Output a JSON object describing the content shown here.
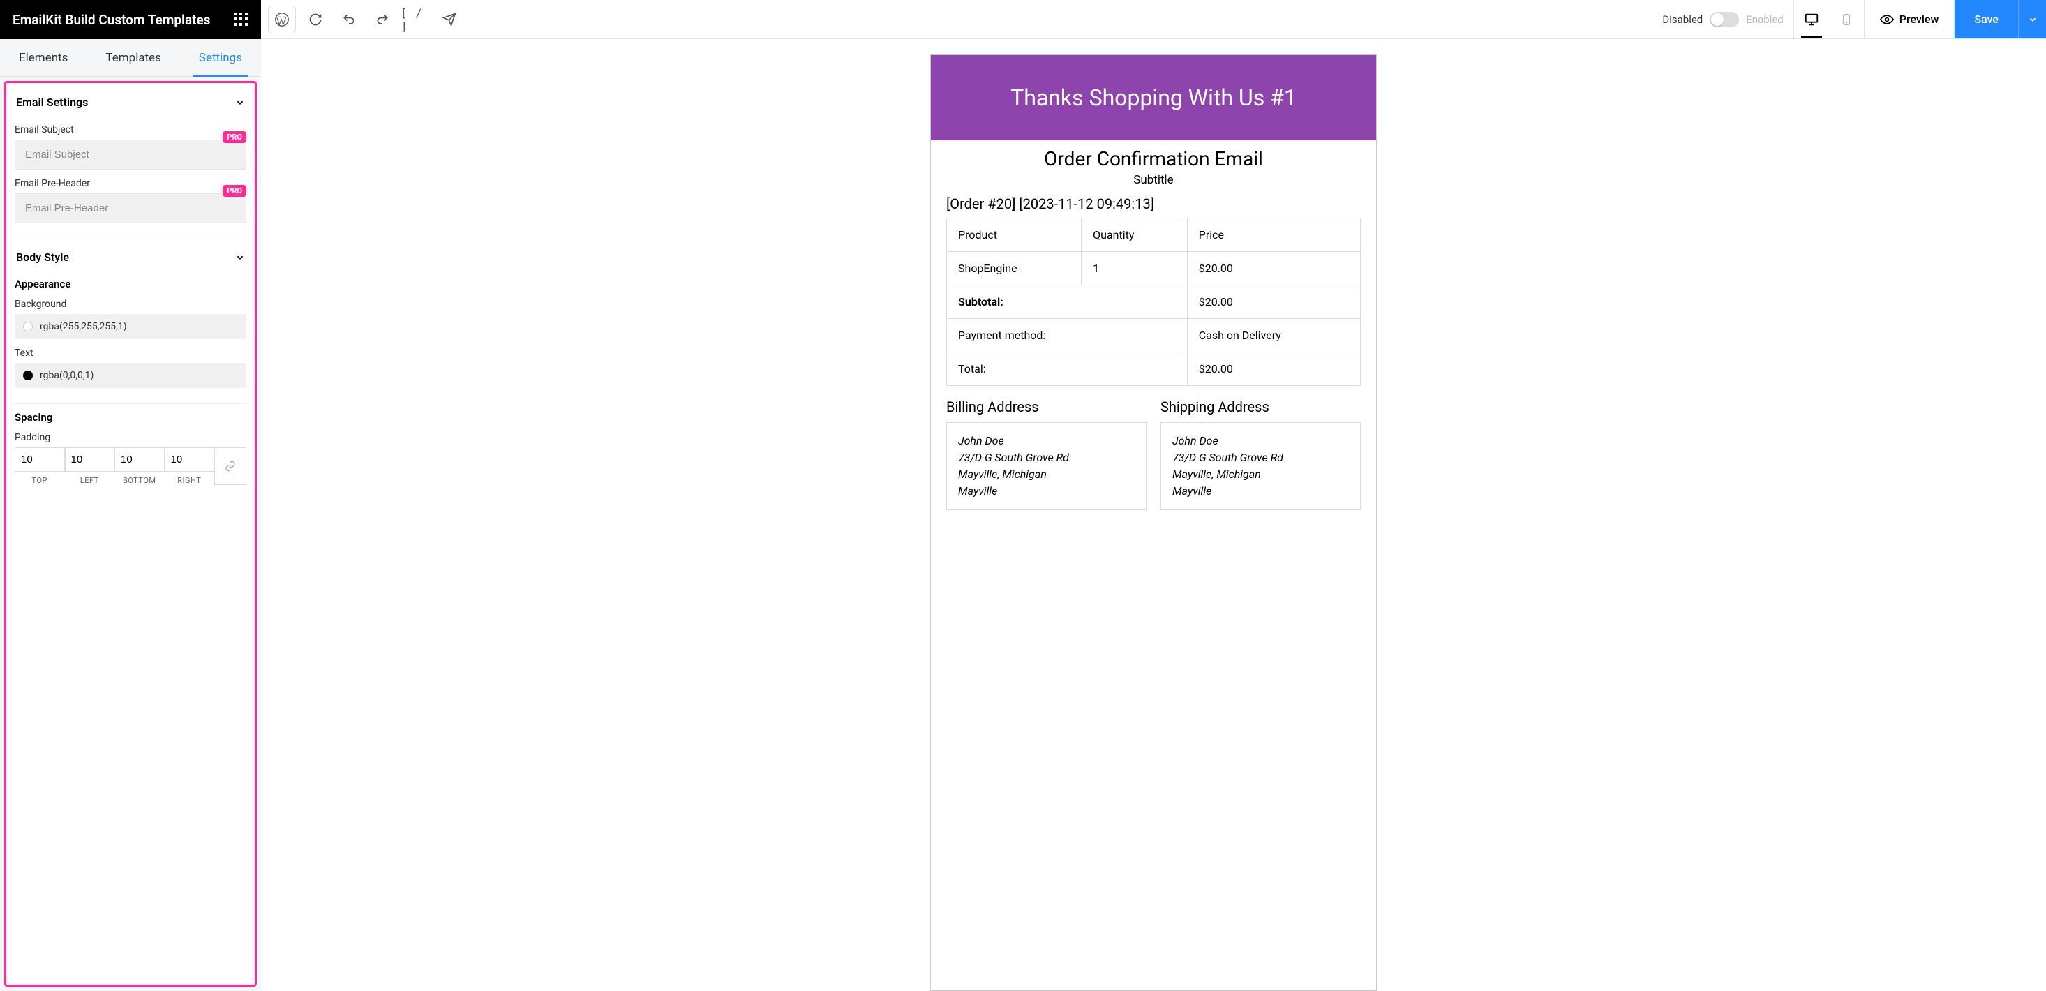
{
  "header": {
    "title": "EmailKit Build Custom Templates",
    "shortcode_btn": "[ / ]",
    "disabled": "Disabled",
    "enabled": "Enabled",
    "preview": "Preview",
    "save": "Save"
  },
  "sidebar": {
    "tabs": {
      "elements": "Elements",
      "templates": "Templates",
      "settings": "Settings"
    },
    "email_settings": {
      "title": "Email Settings",
      "subject_label": "Email Subject",
      "subject_placeholder": "Email Subject",
      "preheader_label": "Email Pre-Header",
      "preheader_placeholder": "Email Pre-Header",
      "pro": "PRO"
    },
    "body_style": {
      "title": "Body Style",
      "appearance": "Appearance",
      "background_label": "Background",
      "background_value": "rgba(255,255,255,1)",
      "text_label": "Text",
      "text_value": "rgba(0,0,0,1)",
      "spacing": "Spacing",
      "padding_label": "Padding",
      "padding": {
        "top": "10",
        "left": "10",
        "bottom": "10",
        "right": "10"
      },
      "padding_labels": {
        "top": "TOP",
        "left": "LEFT",
        "bottom": "BOTTOM",
        "right": "RIGHT"
      }
    }
  },
  "email": {
    "banner": "Thanks Shopping With Us #1",
    "title": "Order Confirmation Email",
    "subtitle": "Subtitle",
    "order_meta": "[Order #20] [2023-11-12 09:49:13]",
    "columns": {
      "product": "Product",
      "quantity": "Quantity",
      "price": "Price"
    },
    "row": {
      "product": "ShopEngine",
      "quantity": "1",
      "price": "$20.00"
    },
    "subtotal_label": "Subtotal:",
    "subtotal_value": "$20.00",
    "payment_label": "Payment method:",
    "payment_value": "Cash on Delivery",
    "total_label": "Total:",
    "total_value": "$20.00",
    "billing_title": "Billing Address",
    "shipping_title": "Shipping Address",
    "address": {
      "name": "John Doe",
      "street": "73/D G South Grove Rd",
      "city_state": "Mayville, Michigan",
      "city": "Mayville"
    }
  }
}
